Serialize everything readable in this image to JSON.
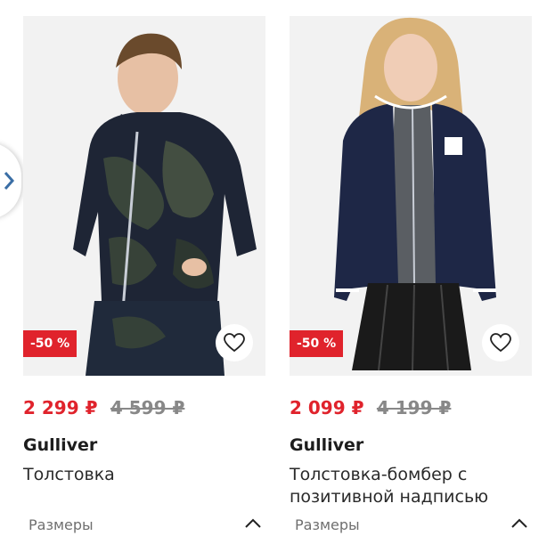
{
  "nav": {
    "arrow_icon": "chevron-right-icon",
    "arrow_color": "#3a6ea5"
  },
  "products": [
    {
      "discount": "-50 %",
      "price_new": "2 299 ₽",
      "price_old": "4 599 ₽",
      "brand": "Gulliver",
      "title": "Толстовка",
      "sizes_label": "Размеры"
    },
    {
      "discount": "-50 %",
      "price_new": "2 099 ₽",
      "price_old": "4 199 ₽",
      "brand": "Gulliver",
      "title": "Толстовка-бомбер с позитивной надписью",
      "sizes_label": "Размеры"
    }
  ],
  "colors": {
    "accent_red": "#e0232c",
    "old_price_grey": "#888888"
  }
}
